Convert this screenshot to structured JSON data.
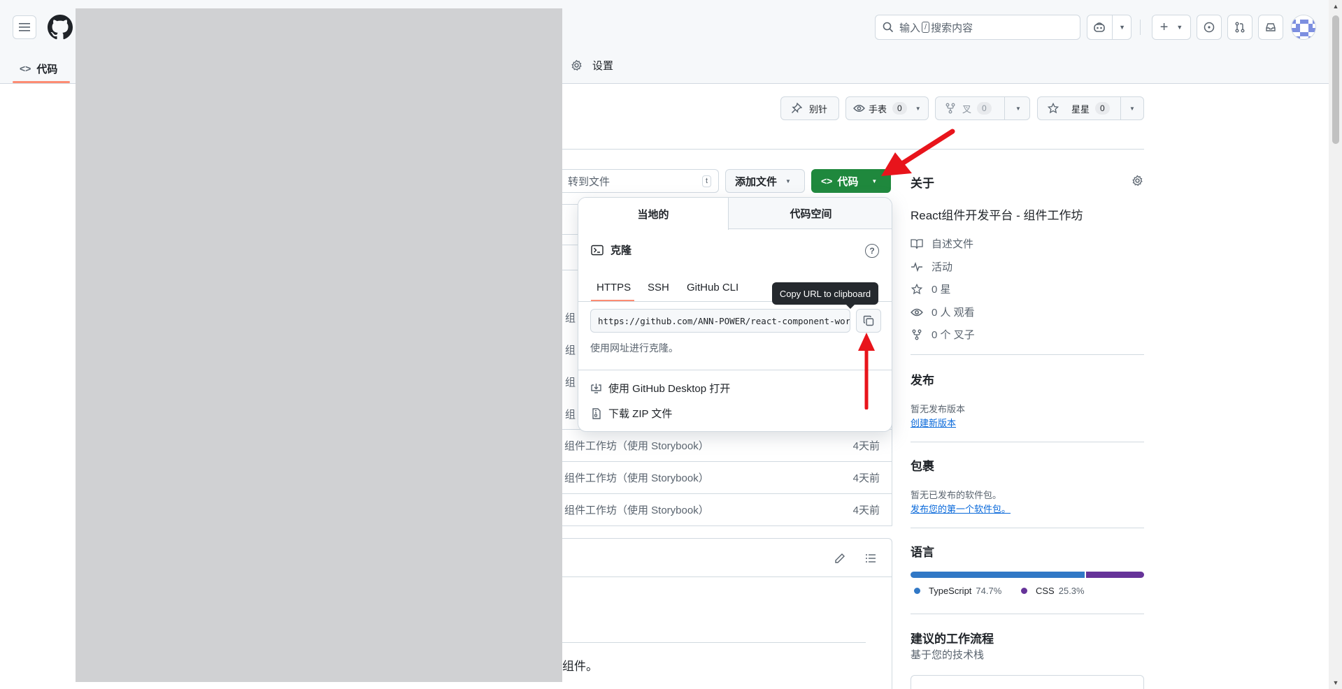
{
  "header": {
    "search_placeholder_prefix": "输入",
    "search_key": "/",
    "search_placeholder_suffix": "搜索内容"
  },
  "nav": {
    "code_tab": "代码",
    "settings_tab": "设置"
  },
  "repo_actions": {
    "pin": "别针",
    "watch": "手表",
    "watch_count": "0",
    "fork": "叉",
    "fork_count": "0",
    "star": "星星",
    "star_count": "0"
  },
  "toolbar": {
    "goto_file": "转到文件",
    "goto_key": "t",
    "add_file": "添加文件",
    "code": "代码"
  },
  "files": [
    {
      "message": "组件工作坊（使用 Storybook）",
      "time": "4天前"
    },
    {
      "message": "组件工作坊（使用 Storybook）",
      "time": "4天前"
    },
    {
      "message": "组件工作坊（使用 Storybook）",
      "time": "4天前"
    }
  ],
  "partial_rows": [
    "组",
    "组",
    "组",
    "组"
  ],
  "readme": {
    "tail_text": "组件。"
  },
  "clone_dropdown": {
    "tabs": [
      "当地的",
      "代码空间"
    ],
    "clone_title": "克隆",
    "help": "?",
    "protocols": [
      "HTTPS",
      "SSH",
      "GitHub CLI"
    ],
    "url": "https://github.com/ANN-POWER/react-component-workshop.git",
    "hint": "使用网址进行克隆。",
    "open_desktop": "使用 GitHub Desktop 打开",
    "download_zip": "下载 ZIP 文件",
    "tooltip": "Copy URL to clipboard"
  },
  "sidebar": {
    "about": "关于",
    "description": "React组件开发平台 - 组件工作坊",
    "readme": "自述文件",
    "activity": "活动",
    "stars": "0 星",
    "watchers": "0 人 观看",
    "forks": "0 个 叉子",
    "releases_title": "发布",
    "releases_none": "暂无发布版本",
    "releases_link": "创建新版本",
    "packages_title": "包裹",
    "packages_none": "暂无已发布的软件包。",
    "packages_link": "发布您的第一个软件包。",
    "languages_title": "语言",
    "languages": [
      {
        "name": "TypeScript",
        "percent": "74.7%",
        "value": 74.7,
        "color": "#3178c6"
      },
      {
        "name": "CSS",
        "percent": "25.3%",
        "value": 25.3,
        "color": "#663399"
      }
    ],
    "workflows_title": "建议的工作流程",
    "workflows_sub": "基于您的技术栈"
  },
  "colors": {
    "primary_green": "#1f883d",
    "annotation_red": "#e8141b",
    "tab_underline": "#fd8c73"
  }
}
